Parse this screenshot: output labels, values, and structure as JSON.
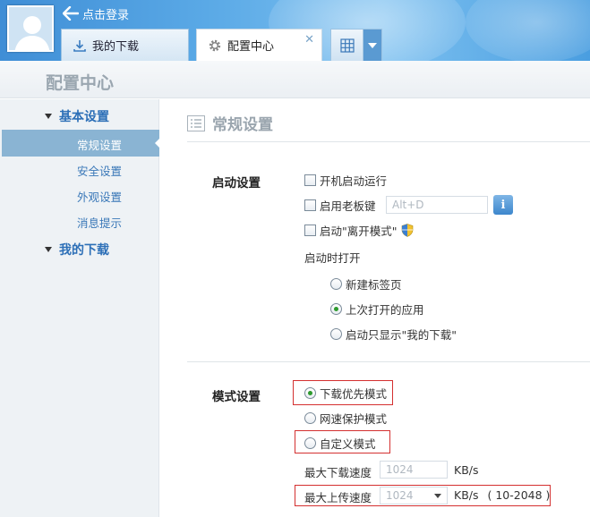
{
  "header": {
    "login_label": "点击登录",
    "tabs": [
      {
        "label": "我的下载",
        "icon": "download-icon"
      },
      {
        "label": "配置中心",
        "icon": "gear-icon",
        "close": "✕"
      }
    ],
    "apps_icon": "grid-icon"
  },
  "titlebar": {
    "title": "配置中心"
  },
  "sidebar": {
    "sections": [
      {
        "label": "基本设置",
        "items": [
          "常规设置",
          "安全设置",
          "外观设置",
          "消息提示"
        ],
        "selected": "常规设置"
      },
      {
        "label": "我的下载",
        "items": []
      }
    ]
  },
  "main": {
    "page_title": "常规设置",
    "startup": {
      "group_label": "启动设置",
      "autostart": {
        "label": "开机启动运行",
        "checked": false
      },
      "boss_key": {
        "label": "启用老板键",
        "checked": false,
        "value": "Alt+D"
      },
      "away_mode": {
        "label": "启动\"离开模式\"",
        "checked": false
      },
      "open_on_start_label": "启动时打开",
      "open_options": [
        {
          "label": "新建标签页",
          "selected": false
        },
        {
          "label": "上次打开的应用",
          "selected": true
        },
        {
          "label": "启动只显示\"我的下载\"",
          "selected": false
        }
      ]
    },
    "mode": {
      "group_label": "模式设置",
      "options": [
        {
          "label": "下载优先模式",
          "selected": true
        },
        {
          "label": "网速保护模式",
          "selected": false
        },
        {
          "label": "自定义模式",
          "selected": false
        }
      ],
      "max_download": {
        "label": "最大下载速度",
        "value": "1024",
        "unit": "KB/s"
      },
      "max_upload": {
        "label": "最大上传速度",
        "value": "1024",
        "unit": "KB/s",
        "range": "( 10-2048 )"
      }
    }
  },
  "colors": {
    "accent": "#2c6fb7",
    "selected_bg": "#8ab4d3",
    "highlight_box": "#d43030",
    "radio_on": "#2d9a2d"
  }
}
